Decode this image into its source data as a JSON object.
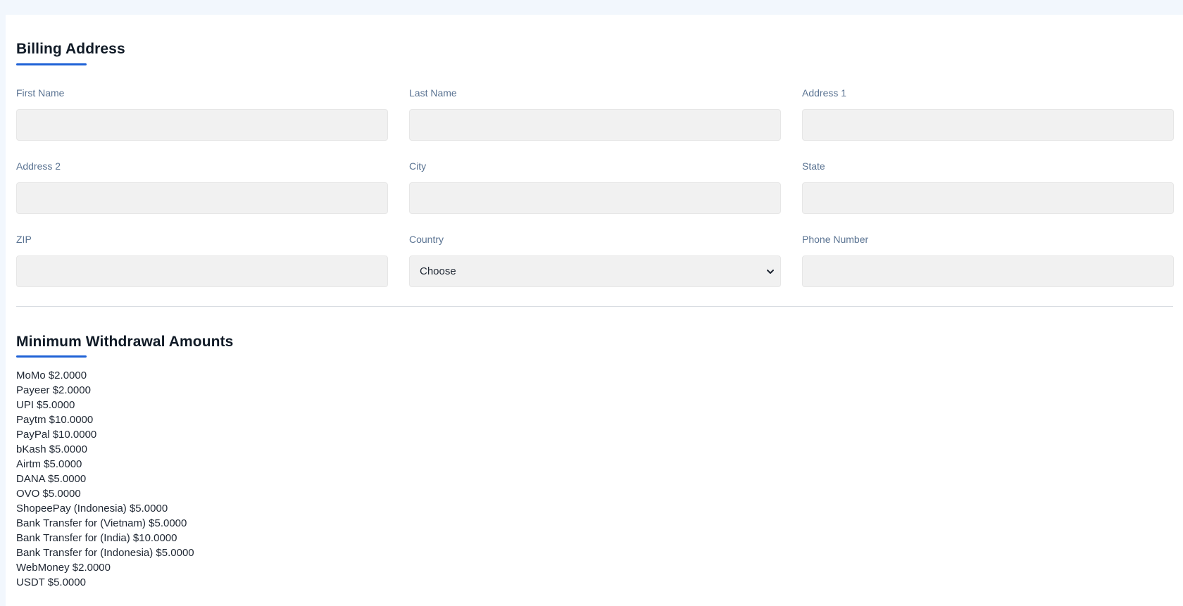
{
  "billing": {
    "title": "Billing Address",
    "fields": [
      {
        "label": "First Name",
        "value": "",
        "placeholder": ""
      },
      {
        "label": "Last Name",
        "value": "",
        "placeholder": ""
      },
      {
        "label": "Address 1",
        "value": "",
        "placeholder": ""
      },
      {
        "label": "Address 2",
        "value": "",
        "placeholder": ""
      },
      {
        "label": "City",
        "value": "",
        "placeholder": ""
      },
      {
        "label": "State",
        "value": "",
        "placeholder": ""
      },
      {
        "label": "ZIP",
        "value": "",
        "placeholder": ""
      },
      {
        "label": "Country",
        "selected": "Choose"
      },
      {
        "label": "Phone Number",
        "value": "",
        "placeholder": ""
      }
    ]
  },
  "withdrawals": {
    "title": "Minimum Withdrawal Amounts",
    "items": [
      "MoMo $2.0000",
      "Payeer $2.0000",
      "UPI $5.0000",
      "Paytm $10.0000",
      "PayPal $10.0000",
      "bKash $5.0000",
      "Airtm $5.0000",
      "DANA $5.0000",
      "OVO $5.0000",
      "ShopeePay (Indonesia) $5.0000",
      "Bank Transfer for (Vietnam) $5.0000",
      "Bank Transfer for (India) $10.0000",
      "Bank Transfer for (Indonesia) $5.0000",
      "WebMoney $2.0000",
      "USDT $5.0000"
    ]
  },
  "colors": {
    "accent": "#1f62d6",
    "label": "#5a7392",
    "input_bg": "#f1f1f1",
    "page_bg": "#f2f7fd"
  },
  "icons": {
    "country_select": "chevron-down-icon"
  }
}
